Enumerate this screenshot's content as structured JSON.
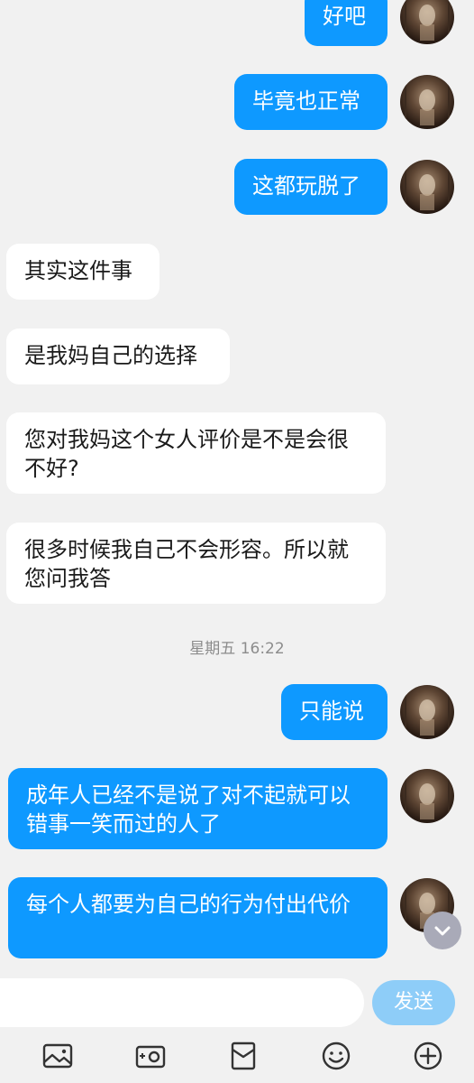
{
  "messages": [
    {
      "type": "out",
      "text": "好吧"
    },
    {
      "type": "out",
      "text": "毕竟也正常"
    },
    {
      "type": "out",
      "text": "这都玩脱了"
    },
    {
      "type": "in",
      "text": "其实这件事"
    },
    {
      "type": "in",
      "text": "是我妈自己的选择"
    },
    {
      "type": "in",
      "text": "您对我妈这个女人评价是不是会很不好?"
    },
    {
      "type": "in",
      "text": "很多时候我自己不会形容。所以就您问我答"
    },
    {
      "type": "out",
      "text": "只能说"
    },
    {
      "type": "out",
      "text": "成年人已经不是说了对不起就可以错事一笑而过的人了"
    },
    {
      "type": "out",
      "text": "每个人都要为自己的行为付出代价"
    }
  ],
  "timestamp": "星期五 16:22",
  "input": {
    "value": "",
    "placeholder": ""
  },
  "send_label": "发送",
  "toolbar": [
    "image-icon",
    "camera-icon",
    "red-packet-icon",
    "emoji-icon",
    "plus-icon"
  ],
  "colors": {
    "outgoing": "#0e99ff",
    "incoming": "#ffffff",
    "background": "#f1f1f1",
    "send_button": "#8ecdf8"
  }
}
